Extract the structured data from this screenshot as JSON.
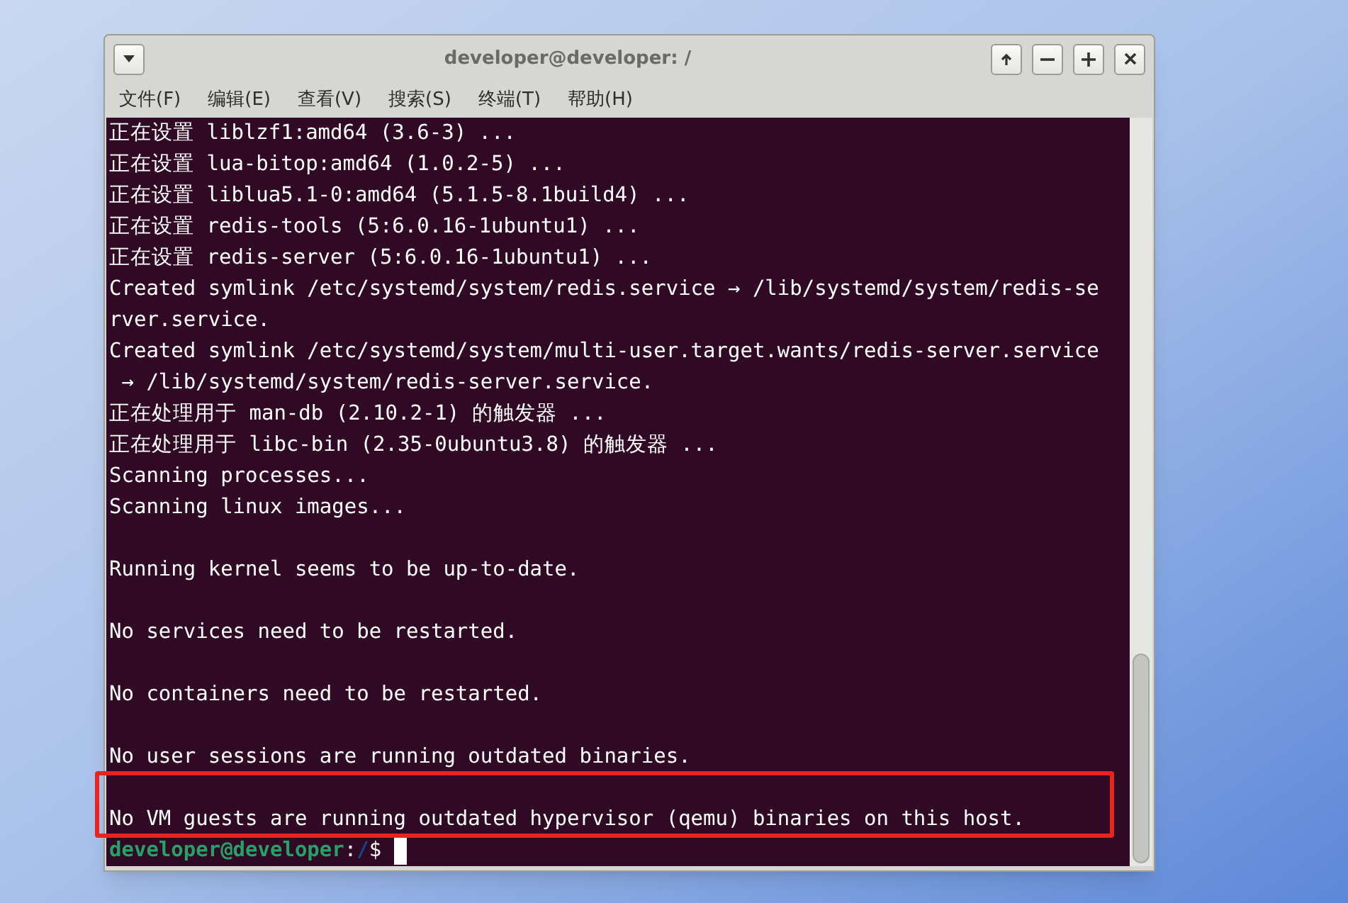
{
  "window": {
    "title": "developer@developer: /"
  },
  "menu": [
    "文件(F)",
    "编辑(E)",
    "查看(V)",
    "搜索(S)",
    "终端(T)",
    "帮助(H)"
  ],
  "terminal": {
    "lines": [
      {
        "kind": "text",
        "text": "正在设置 liblzf1:amd64 (3.6-3) ..."
      },
      {
        "kind": "text",
        "text": "正在设置 lua-bitop:amd64 (1.0.2-5) ..."
      },
      {
        "kind": "text",
        "text": "正在设置 liblua5.1-0:amd64 (5.1.5-8.1build4) ..."
      },
      {
        "kind": "text",
        "text": "正在设置 redis-tools (5:6.0.16-1ubuntu1) ..."
      },
      {
        "kind": "text",
        "text": "正在设置 redis-server (5:6.0.16-1ubuntu1) ..."
      },
      {
        "kind": "text",
        "text": "Created symlink /etc/systemd/system/redis.service → /lib/systemd/system/redis-se"
      },
      {
        "kind": "text",
        "text": "rver.service."
      },
      {
        "kind": "text",
        "text": "Created symlink /etc/systemd/system/multi-user.target.wants/redis-server.service"
      },
      {
        "kind": "text",
        "text": " → /lib/systemd/system/redis-server.service."
      },
      {
        "kind": "text",
        "text": "正在处理用于 man-db (2.10.2-1) 的触发器 ..."
      },
      {
        "kind": "text",
        "text": "正在处理用于 libc-bin (2.35-0ubuntu3.8) 的触发器 ..."
      },
      {
        "kind": "text",
        "text": "Scanning processes..."
      },
      {
        "kind": "text",
        "text": "Scanning linux images..."
      },
      {
        "kind": "blank"
      },
      {
        "kind": "text",
        "text": "Running kernel seems to be up-to-date."
      },
      {
        "kind": "blank"
      },
      {
        "kind": "text",
        "text": "No services need to be restarted."
      },
      {
        "kind": "blank"
      },
      {
        "kind": "text",
        "text": "No containers need to be restarted."
      },
      {
        "kind": "blank"
      },
      {
        "kind": "text",
        "text": "No user sessions are running outdated binaries."
      },
      {
        "kind": "blank"
      },
      {
        "kind": "text",
        "text": "No VM guests are running outdated hypervisor (qemu) binaries on this host."
      },
      {
        "kind": "prompt",
        "user_host": "developer@developer",
        "separator": ":",
        "path": "/",
        "symbol": "$"
      }
    ]
  },
  "highlight_box": true
}
